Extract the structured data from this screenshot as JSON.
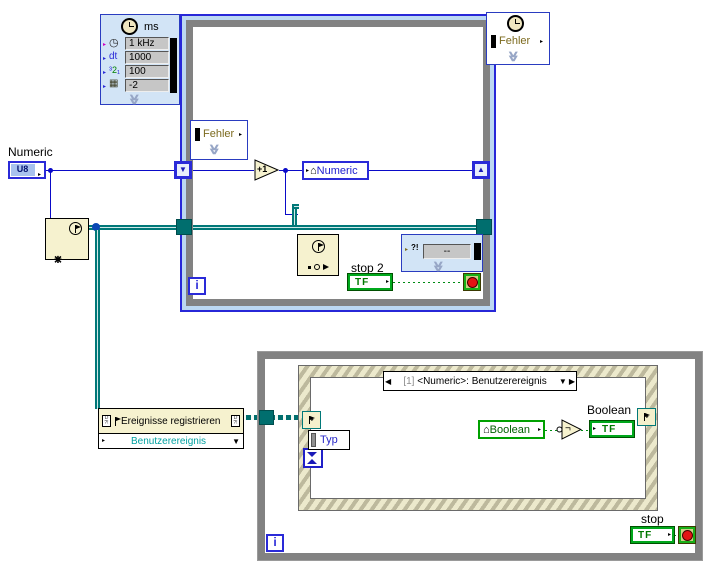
{
  "colors": {
    "wire_blue": "#0a0ac8",
    "refnum_teal": "#007878",
    "boolean_green": "#00a000",
    "structure_gray": "#828282",
    "timed_loop_accent": "#2727d8",
    "panel_blue": "#d2e4f6",
    "node_cream": "#f6f2cf"
  },
  "numeric_control": {
    "label": "Numeric",
    "datatype": "U8"
  },
  "timed_loop": {
    "input_node": {
      "title": "ms",
      "rows": [
        {
          "label": "",
          "value": "1 kHz"
        },
        {
          "label": "dt",
          "value": "1000"
        },
        {
          "label_parts": [
            "³",
            "2",
            "₁"
          ],
          "value": "100"
        },
        {
          "label": "",
          "value": "-2"
        }
      ]
    },
    "output_node": {
      "label": "Fehler"
    },
    "left_data_node": {
      "label": "Fehler"
    },
    "right_data_node": {
      "icon_label": "?!",
      "value": "--"
    },
    "iteration_label": "i",
    "stop_button": {
      "label": "stop 2",
      "tf": "TF"
    }
  },
  "functions": {
    "increment": "+1",
    "not": "¬"
  },
  "numeric_local": {
    "label": "Numeric"
  },
  "register_events": {
    "title": "Ereignisse registrieren",
    "event_type": "Benutzerereignis"
  },
  "while_loop": {
    "iteration_label": "i",
    "stop_button": {
      "label": "stop",
      "tf": "TF"
    }
  },
  "event_structure": {
    "selector": {
      "index": "[1]",
      "label": "<Numeric>: Benutzerereignis"
    },
    "event_data_node": {
      "label": "Typ"
    },
    "boolean_local": {
      "label": "Boolean"
    },
    "boolean_terminal": {
      "label": "Boolean",
      "tf": "TF"
    }
  }
}
